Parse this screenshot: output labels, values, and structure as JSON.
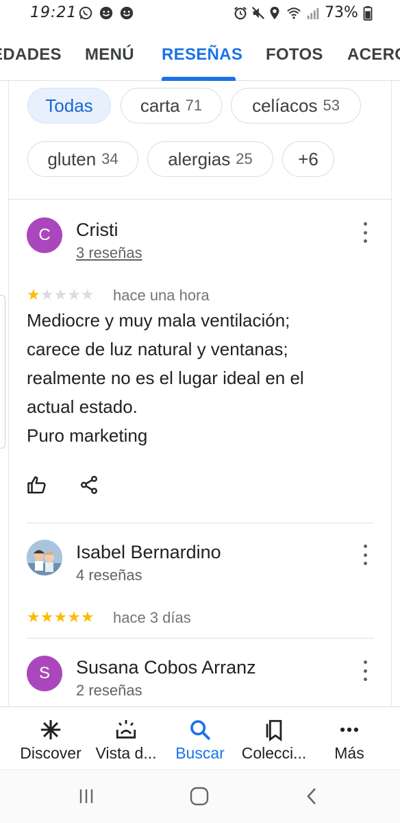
{
  "status_bar": {
    "time": "19:21",
    "battery_percent": "73%",
    "icons": [
      "whatsapp-icon",
      "notification-icon",
      "notification-icon",
      "alarm-icon",
      "mute-icon",
      "location-icon",
      "wifi-icon",
      "signal-icon",
      "battery-icon"
    ]
  },
  "tabs": {
    "items": [
      {
        "label": "EDADES"
      },
      {
        "label": "MENÚ"
      },
      {
        "label": "RESEÑAS",
        "active": true
      },
      {
        "label": "FOTOS"
      },
      {
        "label": "ACERCA"
      }
    ]
  },
  "filters": {
    "chips": [
      {
        "label": "Todas",
        "count": "",
        "selected": true
      },
      {
        "label": "carta",
        "count": "71"
      },
      {
        "label": "celíacos",
        "count": "53"
      },
      {
        "label": "gluten",
        "count": "34"
      },
      {
        "label": "alergias",
        "count": "25"
      },
      {
        "label": "+6",
        "count": ""
      }
    ]
  },
  "reviews": [
    {
      "avatar_letter": "C",
      "avatar_color": "#ab47bc",
      "name": "Cristi",
      "reviews_count": "3 reseñas",
      "rating": 1,
      "time": "hace una hora",
      "text_lines": [
        "Mediocre y muy mala ventilación;",
        "carece de luz natural y ventanas;",
        "realmente no es el lugar ideal en el",
        "actual estado.",
        "Puro marketing"
      ]
    },
    {
      "avatar_photo": true,
      "name": "Isabel Bernardino",
      "reviews_count": "4 reseñas",
      "rating": 5,
      "time": "hace 3 días"
    },
    {
      "avatar_letter": "S",
      "avatar_color": "#ab47bc",
      "name": "Susana Cobos Arranz",
      "reviews_count": "2 reseñas"
    }
  ],
  "bottom_nav": {
    "items": [
      {
        "label": "Discover",
        "icon": "asterisk-icon"
      },
      {
        "label": "Vista d...",
        "icon": "sunrise-icon"
      },
      {
        "label": "Buscar",
        "icon": "search-icon",
        "active": true
      },
      {
        "label": "Colecci...",
        "icon": "bookmarks-icon"
      },
      {
        "label": "Más",
        "icon": "more-icon"
      }
    ]
  },
  "colors": {
    "accent": "#1a73e8",
    "star": "#fbbc04",
    "avatar": "#ab47bc"
  }
}
